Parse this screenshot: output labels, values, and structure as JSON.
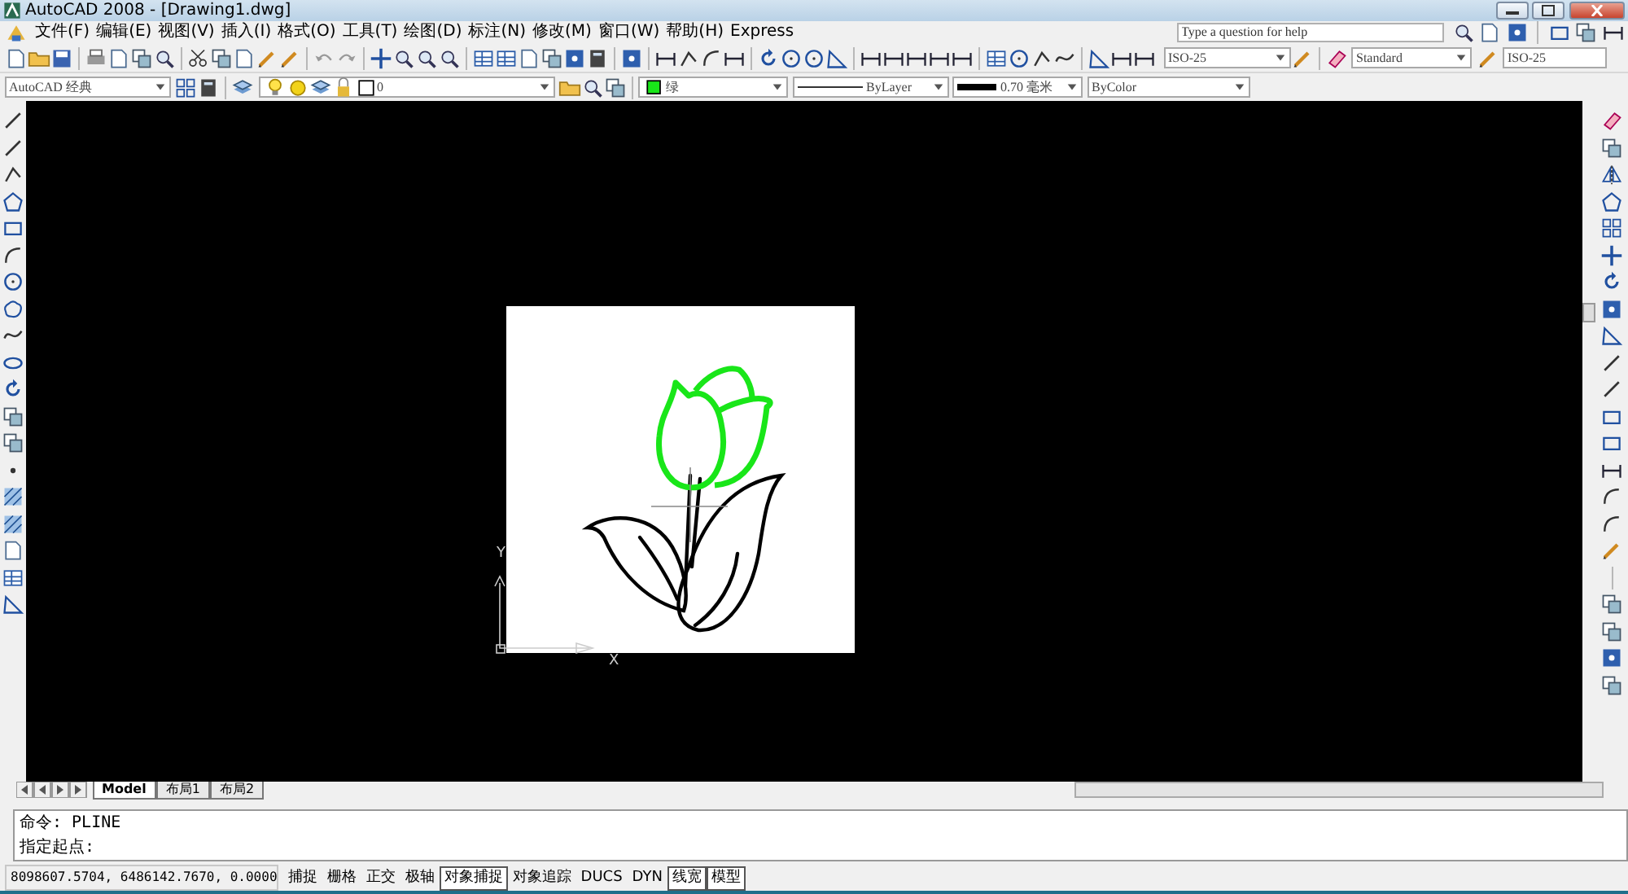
{
  "window": {
    "title": "AutoCAD 2008 - [Drawing1.dwg]"
  },
  "menu": [
    "文件(F)",
    "编辑(E)",
    "视图(V)",
    "插入(I)",
    "格式(O)",
    "工具(T)",
    "绘图(D)",
    "标注(N)",
    "修改(M)",
    "窗口(W)",
    "帮助(H)",
    "Express"
  ],
  "help_search": {
    "placeholder": "Type a question for help"
  },
  "styles_toolbar": {
    "dimension_toolbar_style": "ISO-25",
    "text_style": "Standard",
    "dimension_style": "ISO-25"
  },
  "workspace": "AutoCAD 经典",
  "layer": {
    "name": "0"
  },
  "properties": {
    "color_name": "绿",
    "linetype": "ByLayer",
    "lineweight": "0.70 毫米",
    "plot_style": "ByColor"
  },
  "ucs": {
    "y_label": "Y",
    "x_label": "X"
  },
  "layout_tabs": [
    {
      "label": "Model",
      "selected": true
    },
    {
      "label": "布局1",
      "selected": false
    },
    {
      "label": "布局2",
      "selected": false
    }
  ],
  "command_lines": [
    "命令:  PLINE",
    "指定起点:"
  ],
  "coordinates": "8098607.5704, 6486142.7670, 0.0000",
  "status_toggles": [
    {
      "label": "捕捉",
      "on": false
    },
    {
      "label": "栅格",
      "on": false
    },
    {
      "label": "正交",
      "on": false
    },
    {
      "label": "极轴",
      "on": false
    },
    {
      "label": "对象捕捉",
      "on": true
    },
    {
      "label": "对象追踪",
      "on": false
    },
    {
      "label": "DUCS",
      "on": false
    },
    {
      "label": "DYN",
      "on": false
    },
    {
      "label": "线宽",
      "on": true
    },
    {
      "label": "模型",
      "on": true
    }
  ]
}
